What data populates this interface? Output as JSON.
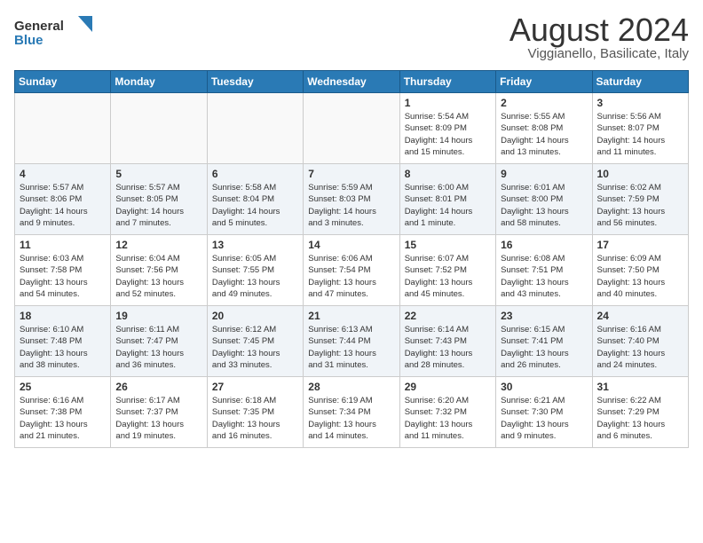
{
  "header": {
    "logo_line1": "General",
    "logo_line2": "Blue",
    "month": "August 2024",
    "location": "Viggianello, Basilicate, Italy"
  },
  "days_of_week": [
    "Sunday",
    "Monday",
    "Tuesday",
    "Wednesday",
    "Thursday",
    "Friday",
    "Saturday"
  ],
  "weeks": [
    [
      {
        "day": "",
        "info": ""
      },
      {
        "day": "",
        "info": ""
      },
      {
        "day": "",
        "info": ""
      },
      {
        "day": "",
        "info": ""
      },
      {
        "day": "1",
        "info": "Sunrise: 5:54 AM\nSunset: 8:09 PM\nDaylight: 14 hours\nand 15 minutes."
      },
      {
        "day": "2",
        "info": "Sunrise: 5:55 AM\nSunset: 8:08 PM\nDaylight: 14 hours\nand 13 minutes."
      },
      {
        "day": "3",
        "info": "Sunrise: 5:56 AM\nSunset: 8:07 PM\nDaylight: 14 hours\nand 11 minutes."
      }
    ],
    [
      {
        "day": "4",
        "info": "Sunrise: 5:57 AM\nSunset: 8:06 PM\nDaylight: 14 hours\nand 9 minutes."
      },
      {
        "day": "5",
        "info": "Sunrise: 5:57 AM\nSunset: 8:05 PM\nDaylight: 14 hours\nand 7 minutes."
      },
      {
        "day": "6",
        "info": "Sunrise: 5:58 AM\nSunset: 8:04 PM\nDaylight: 14 hours\nand 5 minutes."
      },
      {
        "day": "7",
        "info": "Sunrise: 5:59 AM\nSunset: 8:03 PM\nDaylight: 14 hours\nand 3 minutes."
      },
      {
        "day": "8",
        "info": "Sunrise: 6:00 AM\nSunset: 8:01 PM\nDaylight: 14 hours\nand 1 minute."
      },
      {
        "day": "9",
        "info": "Sunrise: 6:01 AM\nSunset: 8:00 PM\nDaylight: 13 hours\nand 58 minutes."
      },
      {
        "day": "10",
        "info": "Sunrise: 6:02 AM\nSunset: 7:59 PM\nDaylight: 13 hours\nand 56 minutes."
      }
    ],
    [
      {
        "day": "11",
        "info": "Sunrise: 6:03 AM\nSunset: 7:58 PM\nDaylight: 13 hours\nand 54 minutes."
      },
      {
        "day": "12",
        "info": "Sunrise: 6:04 AM\nSunset: 7:56 PM\nDaylight: 13 hours\nand 52 minutes."
      },
      {
        "day": "13",
        "info": "Sunrise: 6:05 AM\nSunset: 7:55 PM\nDaylight: 13 hours\nand 49 minutes."
      },
      {
        "day": "14",
        "info": "Sunrise: 6:06 AM\nSunset: 7:54 PM\nDaylight: 13 hours\nand 47 minutes."
      },
      {
        "day": "15",
        "info": "Sunrise: 6:07 AM\nSunset: 7:52 PM\nDaylight: 13 hours\nand 45 minutes."
      },
      {
        "day": "16",
        "info": "Sunrise: 6:08 AM\nSunset: 7:51 PM\nDaylight: 13 hours\nand 43 minutes."
      },
      {
        "day": "17",
        "info": "Sunrise: 6:09 AM\nSunset: 7:50 PM\nDaylight: 13 hours\nand 40 minutes."
      }
    ],
    [
      {
        "day": "18",
        "info": "Sunrise: 6:10 AM\nSunset: 7:48 PM\nDaylight: 13 hours\nand 38 minutes."
      },
      {
        "day": "19",
        "info": "Sunrise: 6:11 AM\nSunset: 7:47 PM\nDaylight: 13 hours\nand 36 minutes."
      },
      {
        "day": "20",
        "info": "Sunrise: 6:12 AM\nSunset: 7:45 PM\nDaylight: 13 hours\nand 33 minutes."
      },
      {
        "day": "21",
        "info": "Sunrise: 6:13 AM\nSunset: 7:44 PM\nDaylight: 13 hours\nand 31 minutes."
      },
      {
        "day": "22",
        "info": "Sunrise: 6:14 AM\nSunset: 7:43 PM\nDaylight: 13 hours\nand 28 minutes."
      },
      {
        "day": "23",
        "info": "Sunrise: 6:15 AM\nSunset: 7:41 PM\nDaylight: 13 hours\nand 26 minutes."
      },
      {
        "day": "24",
        "info": "Sunrise: 6:16 AM\nSunset: 7:40 PM\nDaylight: 13 hours\nand 24 minutes."
      }
    ],
    [
      {
        "day": "25",
        "info": "Sunrise: 6:16 AM\nSunset: 7:38 PM\nDaylight: 13 hours\nand 21 minutes."
      },
      {
        "day": "26",
        "info": "Sunrise: 6:17 AM\nSunset: 7:37 PM\nDaylight: 13 hours\nand 19 minutes."
      },
      {
        "day": "27",
        "info": "Sunrise: 6:18 AM\nSunset: 7:35 PM\nDaylight: 13 hours\nand 16 minutes."
      },
      {
        "day": "28",
        "info": "Sunrise: 6:19 AM\nSunset: 7:34 PM\nDaylight: 13 hours\nand 14 minutes."
      },
      {
        "day": "29",
        "info": "Sunrise: 6:20 AM\nSunset: 7:32 PM\nDaylight: 13 hours\nand 11 minutes."
      },
      {
        "day": "30",
        "info": "Sunrise: 6:21 AM\nSunset: 7:30 PM\nDaylight: 13 hours\nand 9 minutes."
      },
      {
        "day": "31",
        "info": "Sunrise: 6:22 AM\nSunset: 7:29 PM\nDaylight: 13 hours\nand 6 minutes."
      }
    ]
  ]
}
